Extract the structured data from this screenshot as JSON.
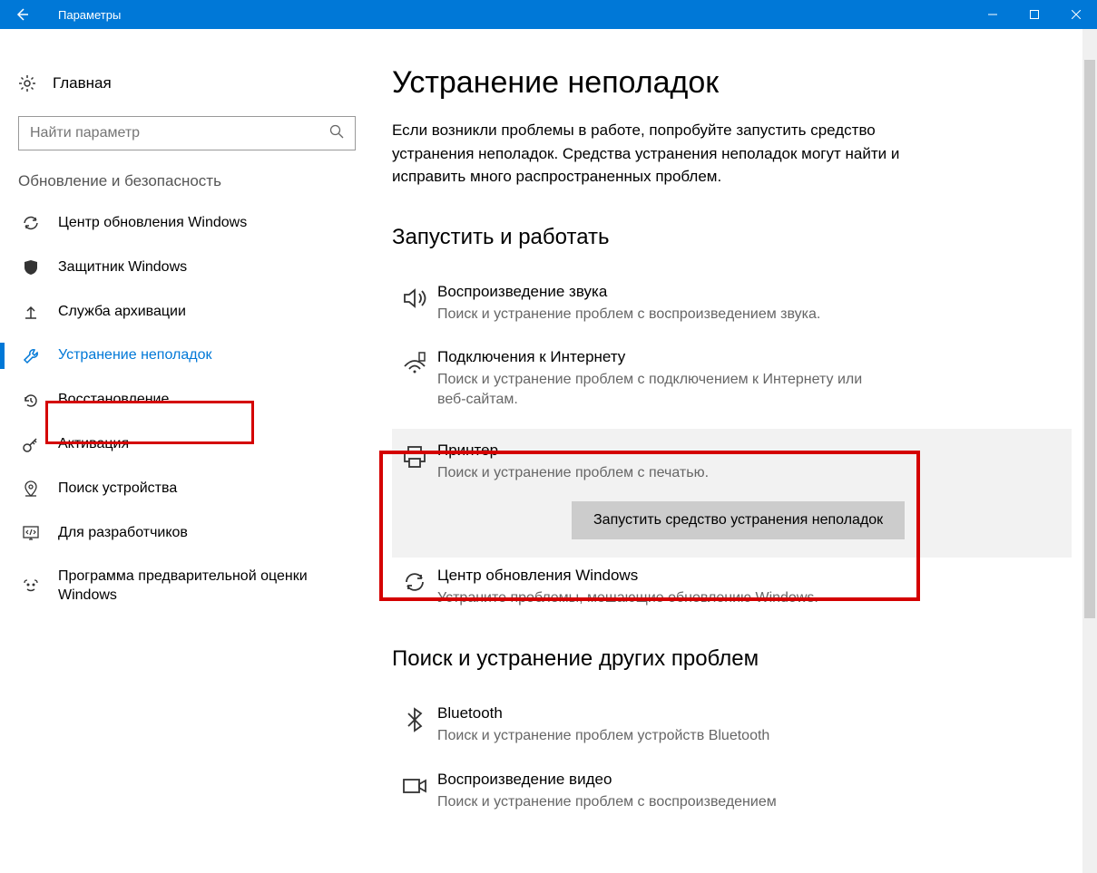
{
  "titlebar": {
    "title": "Параметры"
  },
  "sidebar": {
    "home": "Главная",
    "search_placeholder": "Найти параметр",
    "section": "Обновление и безопасность",
    "items": [
      {
        "label": "Центр обновления Windows"
      },
      {
        "label": "Защитник Windows"
      },
      {
        "label": "Служба архивации"
      },
      {
        "label": "Устранение неполадок"
      },
      {
        "label": "Восстановление"
      },
      {
        "label": "Активация"
      },
      {
        "label": "Поиск устройства"
      },
      {
        "label": "Для разработчиков"
      },
      {
        "label": "Программа предварительной оценки Windows"
      }
    ]
  },
  "main": {
    "title": "Устранение неполадок",
    "desc": "Если возникли проблемы в работе, попробуйте запустить средство устранения неполадок. Средства устранения неполадок могут найти и исправить много распространенных проблем.",
    "section_run": "Запустить и работать",
    "items_run": [
      {
        "title": "Воспроизведение звука",
        "desc": "Поиск и устранение проблем с воспроизведением звука."
      },
      {
        "title": "Подключения к Интернету",
        "desc": "Поиск и устранение проблем с подключением к Интернету или веб-сайтам."
      },
      {
        "title": "Принтер",
        "desc": "Поиск и устранение проблем с печатью."
      },
      {
        "title": "Центр обновления Windows",
        "desc": "Устраните проблемы, мешающие обновлению Windows."
      }
    ],
    "run_button": "Запустить средство устранения неполадок",
    "section_other": "Поиск и устранение других проблем",
    "items_other": [
      {
        "title": "Bluetooth",
        "desc": "Поиск и устранение проблем устройств Bluetooth"
      },
      {
        "title": "Воспроизведение видео",
        "desc": "Поиск и устранение проблем с воспроизведением"
      }
    ]
  }
}
